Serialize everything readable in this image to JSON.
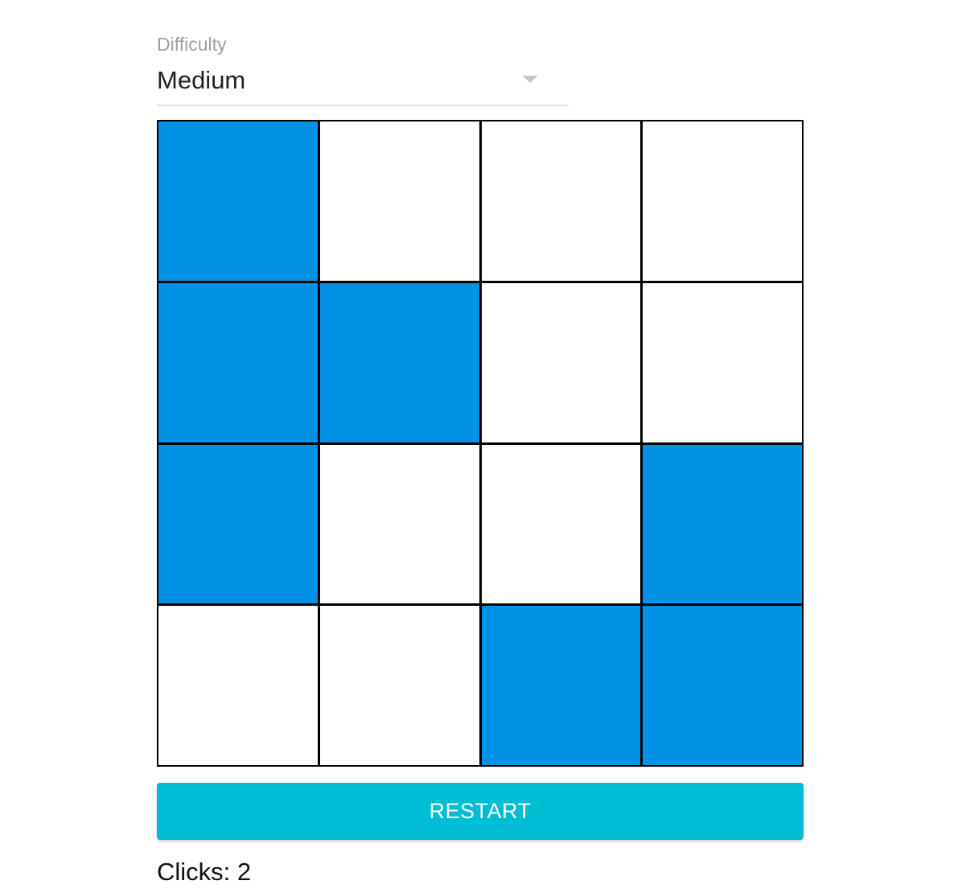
{
  "difficulty": {
    "label": "Difficulty",
    "value": "Medium"
  },
  "board": {
    "rows": 4,
    "cols": 4,
    "on_color": "#0192e6",
    "off_color": "#ffffff",
    "cells": [
      [
        true,
        false,
        false,
        false
      ],
      [
        true,
        true,
        false,
        false
      ],
      [
        true,
        false,
        false,
        true
      ],
      [
        false,
        false,
        true,
        true
      ]
    ]
  },
  "restart": {
    "label": "RESTART",
    "color": "#00bcd4"
  },
  "clicks": {
    "label": "Clicks: 2"
  }
}
